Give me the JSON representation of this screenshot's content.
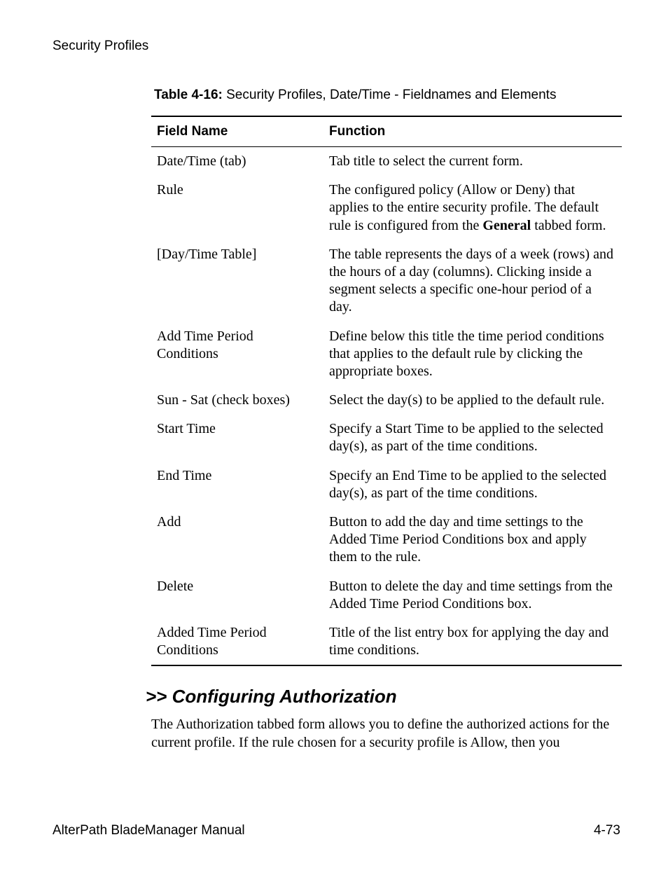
{
  "header": "Security Profiles",
  "table": {
    "caption_label": "Table 4-16:",
    "caption_text": " Security Profiles, Date/Time - Fieldnames and Elements",
    "columns": [
      "Field Name",
      "Function"
    ],
    "rows": [
      {
        "field": "Date/Time (tab)",
        "function": "Tab title to select the current form."
      },
      {
        "field": "Rule",
        "function_pre": "The configured policy (Allow or Deny) that applies to the entire security profile. The default rule is configured from the ",
        "function_bold": "General",
        "function_post": " tabbed form."
      },
      {
        "field": "[Day/Time Table]",
        "function": "The table represents the days of a week (rows) and the hours of a day (columns). Clicking inside a segment selects a specific one-hour period of a day."
      },
      {
        "field": "Add Time Period Conditions",
        "function": "Define below this title the time period conditions that applies to the default rule by clicking the appropriate boxes."
      },
      {
        "field": "Sun - Sat (check boxes)",
        "function": "Select the day(s) to be applied to the default rule."
      },
      {
        "field": "Start Time",
        "function": "Specify a Start Time to be applied to the selected day(s), as part of the time conditions."
      },
      {
        "field": "End Time",
        "function": "Specify an End Time to be applied to the selected day(s), as part of the time conditions."
      },
      {
        "field": "Add",
        "function": "Button to add the day and time settings to the Added Time Period Conditions box and apply them to the rule."
      },
      {
        "field": "Delete",
        "function": "Button to delete the day and time settings from the Added Time Period Conditions box."
      },
      {
        "field": "Added Time Period Conditions",
        "function": "Title of the list entry box for applying the day and time conditions."
      }
    ]
  },
  "section": {
    "heading": ">> Configuring Authorization",
    "paragraph": "The Authorization tabbed form allows you to define the authorized actions for the current profile. If the rule chosen for a security profile is Allow, then you"
  },
  "footer": {
    "left": "AlterPath BladeManager Manual",
    "right": "4-73"
  }
}
